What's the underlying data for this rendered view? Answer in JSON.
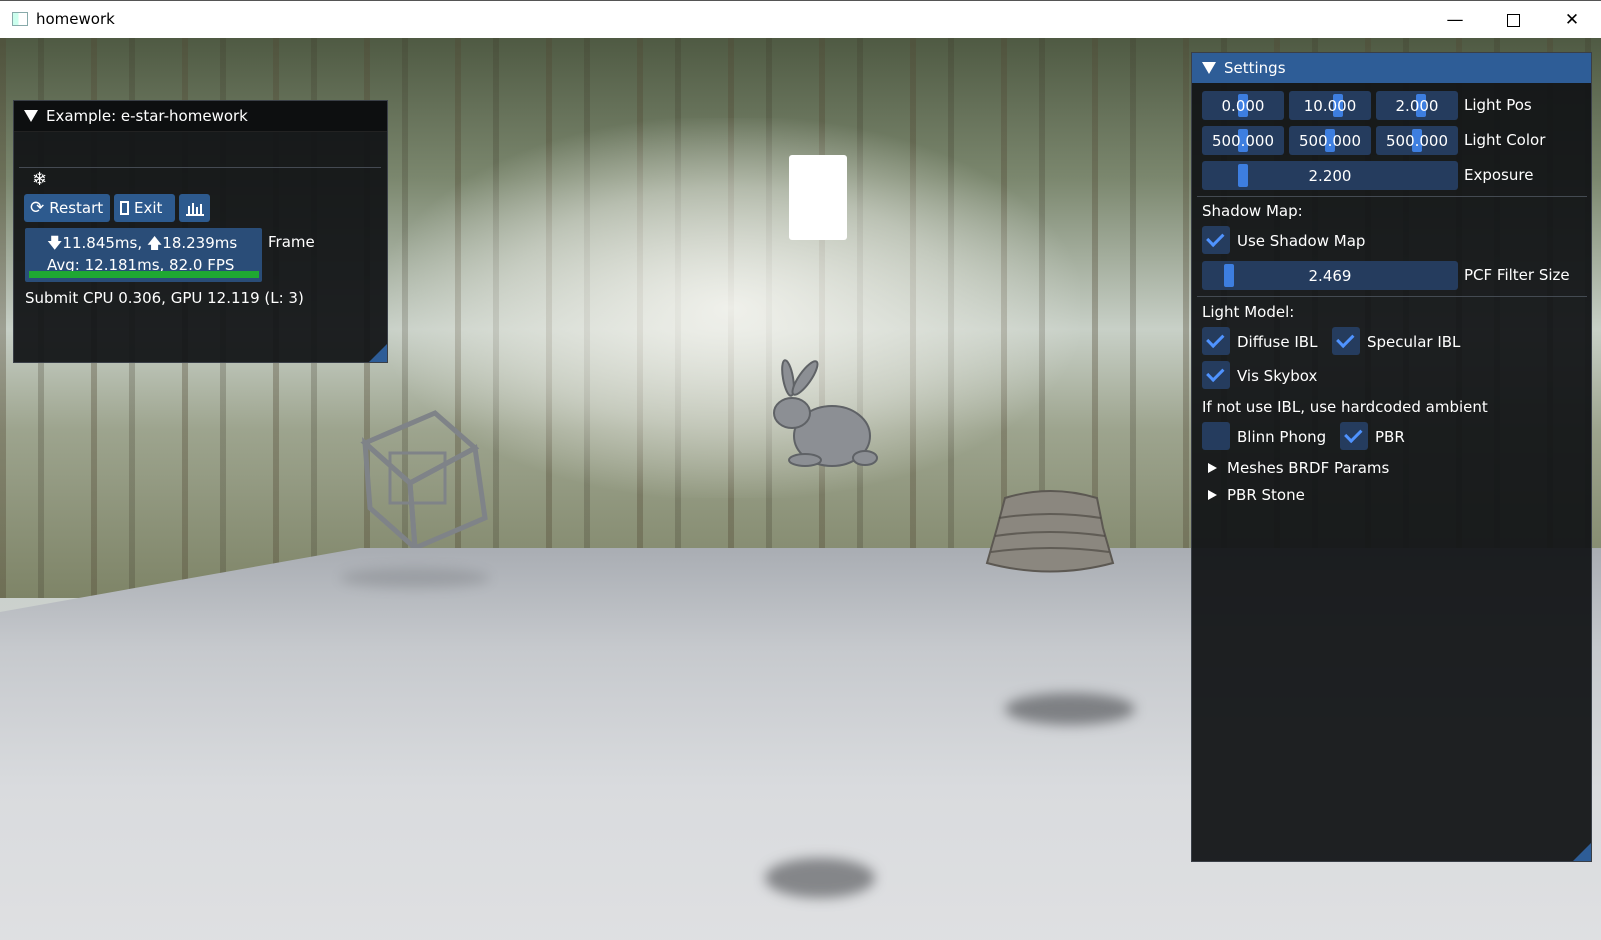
{
  "window": {
    "title": "homework",
    "minimize": "—",
    "close": "✕"
  },
  "example": {
    "title": "Example: e-star-homework",
    "snowflake": "❄",
    "restart_label": "Restart",
    "exit_label": "Exit",
    "frame_line1": "🡇11.845ms, 🡅18.239ms",
    "frame_line2": "Avg: 12.181ms, 82.0 FPS",
    "frame_label": "Frame",
    "submit_text": "Submit CPU 0.306, GPU 12.119 (L: 3)"
  },
  "settings": {
    "title": "Settings",
    "light_pos": {
      "values": [
        "0.000",
        "10.000",
        "2.000"
      ],
      "label": "Light Pos"
    },
    "light_color": {
      "values": [
        "500.000",
        "500.000",
        "500.000"
      ],
      "label": "Light Color"
    },
    "exposure": {
      "value": "2.200",
      "label": "Exposure"
    },
    "shadow_map_header": "Shadow Map:",
    "use_shadow_map": {
      "label": "Use Shadow Map",
      "checked": true
    },
    "pcf_filter_size": {
      "value": "2.469",
      "label": "PCF Filter Size"
    },
    "light_model_header": "Light Model:",
    "diffuse_ibl": {
      "label": "Diffuse IBL",
      "checked": true
    },
    "specular_ibl": {
      "label": "Specular IBL",
      "checked": true
    },
    "vis_skybox": {
      "label": "Vis Skybox",
      "checked": true
    },
    "ibl_note": "If not use IBL, use hardcoded ambient",
    "blinn_phong": {
      "label": "Blinn Phong",
      "checked": false
    },
    "pbr": {
      "label": "PBR",
      "checked": true
    },
    "tree_meshes": "Meshes BRDF Params",
    "tree_stone": "PBR Stone"
  },
  "colors": {
    "accent": "#2e5d97",
    "slider_bg": "#253c5e",
    "slider_grab": "#3d7ee0",
    "check": "#4f93ff",
    "fps_bar": "#1fa832"
  }
}
